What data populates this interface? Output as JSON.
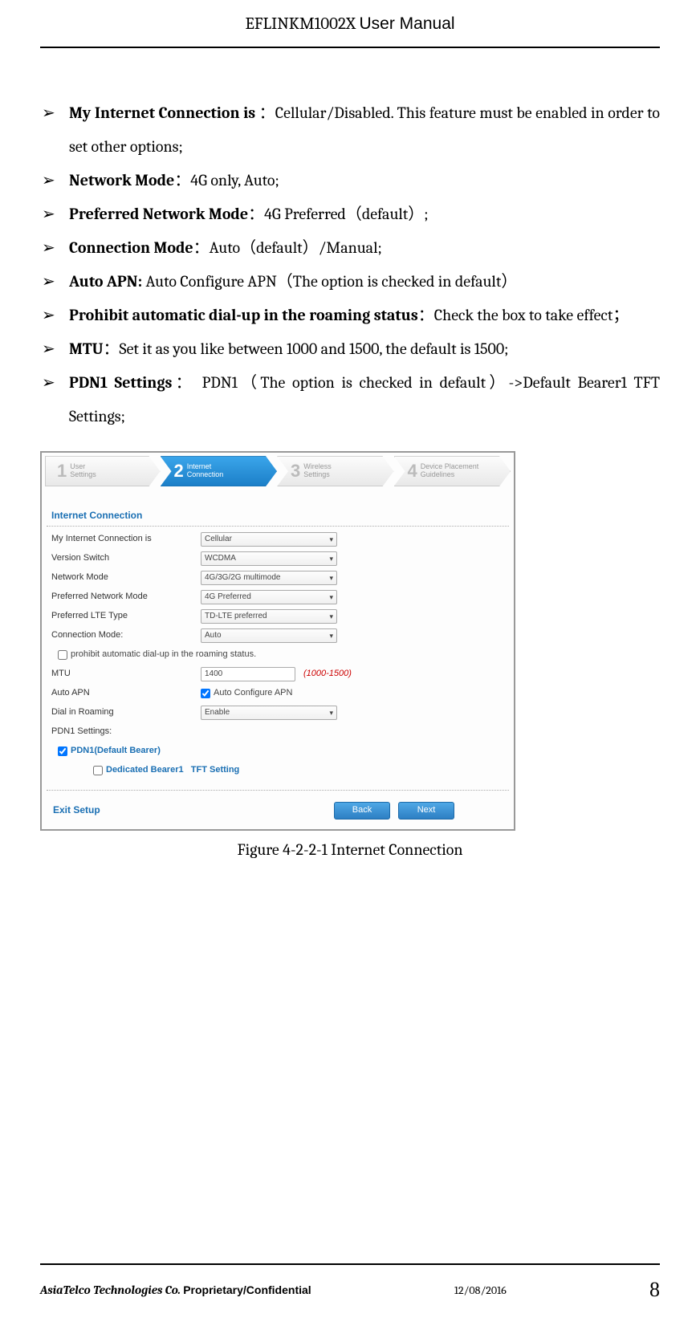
{
  "header": {
    "title_a": "EFLINKM1002X ",
    "title_b": "User Manual"
  },
  "bullets": [
    {
      "bold": "My Internet Connection is ",
      "rest": "：Cellular/Disabled. This feature must be enabled in order to set other options;"
    },
    {
      "bold": "Network Mode",
      "rest": "：4G only, Auto;"
    },
    {
      "bold": "Preferred Network Mode",
      "rest": "：4G Preferred（default）;"
    },
    {
      "bold": "Connection Mode",
      "rest": "：Auto（default）/Manual;"
    },
    {
      "bold": "Auto APN: ",
      "rest": "Auto Configure APN（The option is checked in default）"
    },
    {
      "bold": "Prohibit automatic dial-up in the roaming status",
      "rest": "：Check the box to take effect；"
    },
    {
      "bold": "MTU",
      "rest": "：Set it as you like between 1000 and 1500,    the default is 1500;"
    },
    {
      "bold": "PDN1 Settings",
      "rest": "： PDN1（The option is checked in default）->Default Bearer1 TFT Settings;"
    }
  ],
  "steps": [
    {
      "num": "1",
      "t1": "User",
      "t2": "Settings"
    },
    {
      "num": "2",
      "t1": "Internet",
      "t2": "Connection"
    },
    {
      "num": "3",
      "t1": "Wireless",
      "t2": "Settings"
    },
    {
      "num": "4",
      "t1": "Device Placement",
      "t2": "Guidelines"
    }
  ],
  "panel": {
    "title": "Internet Connection",
    "rows": {
      "r1_label": "My Internet Connection is",
      "r1_val": "Cellular",
      "r2_label": "Version Switch",
      "r2_val": "WCDMA",
      "r3_label": "Network Mode",
      "r3_val": "4G/3G/2G multimode",
      "r4_label": "Preferred Network Mode",
      "r4_val": "4G Preferred",
      "r5_label": "Preferred LTE Type",
      "r5_val": "TD-LTE preferred",
      "r6_label": "Connection Mode:",
      "r6_val": "Auto",
      "r7_label": "prohibit automatic dial-up in the roaming status.",
      "r8_label": "MTU",
      "r8_val": "1400",
      "r8_hint": "(1000-1500)",
      "r9_label": "Auto APN",
      "r9_val": "Auto Configure APN",
      "r10_label": "Dial in Roaming",
      "r10_val": "Enable",
      "r11_label": "PDN1 Settings:",
      "r12_label": "PDN1(Default Bearer)",
      "r13_a": "Dedicated Bearer1",
      "r13_b": "TFT Setting"
    },
    "exit": "Exit Setup",
    "back": "Back",
    "next": "Next"
  },
  "caption": "Figure 4-2-2-1 Internet Connection",
  "footer": {
    "company": "AsiaTelco Technologies Co. ",
    "pc": "Proprietary/Confidential",
    "date": "12/08/2016",
    "page": "8"
  }
}
